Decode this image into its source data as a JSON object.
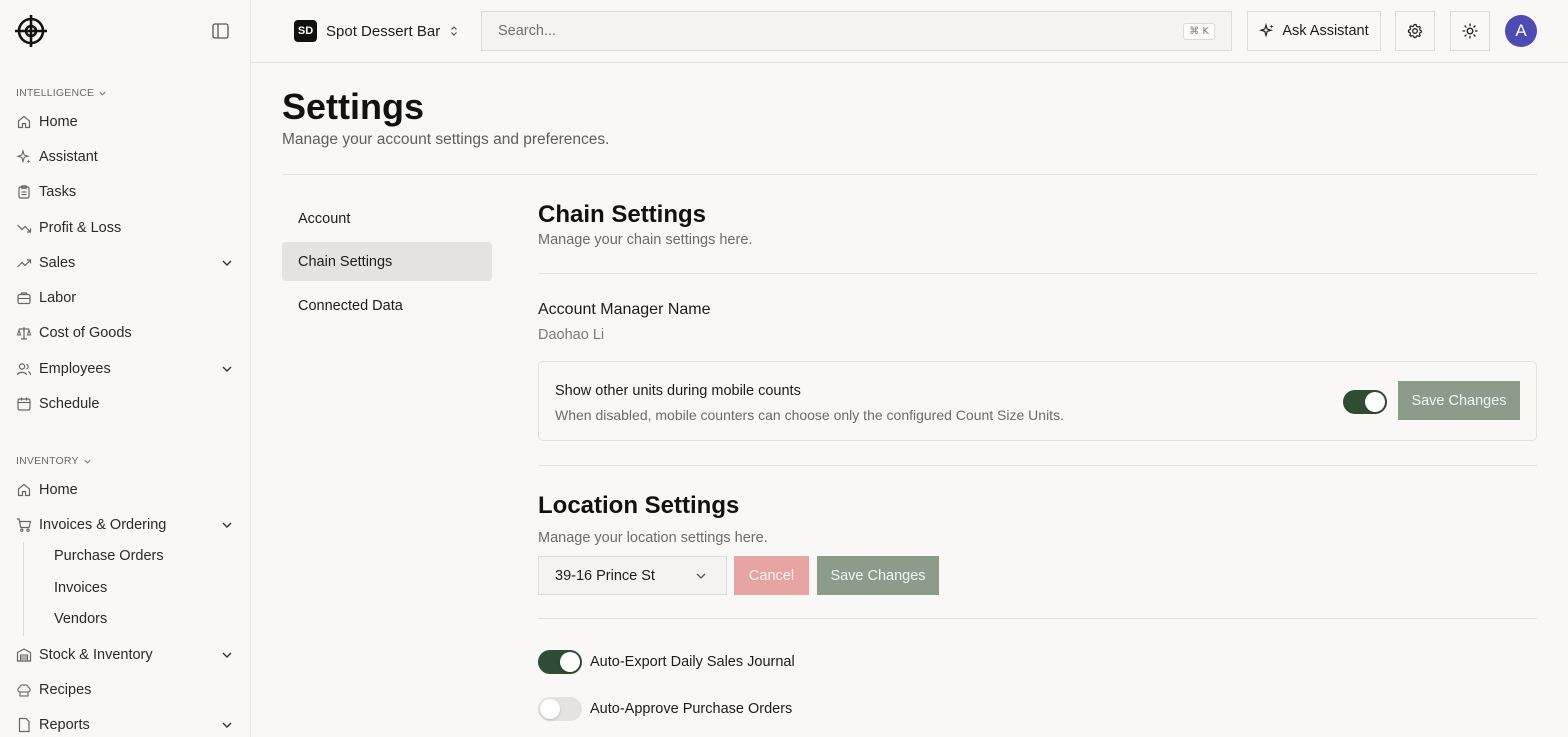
{
  "sidebar": {
    "intelligence_label": "INTELLIGENCE",
    "inventory_label": "INVENTORY",
    "intelligence_items": [
      {
        "label": "Home",
        "icon": "home-icon"
      },
      {
        "label": "Assistant",
        "icon": "sparkle-icon"
      },
      {
        "label": "Tasks",
        "icon": "clipboard-icon"
      },
      {
        "label": "Profit & Loss",
        "icon": "trending-down-icon"
      },
      {
        "label": "Sales",
        "icon": "trending-up-icon"
      },
      {
        "label": "Labor",
        "icon": "briefcase-icon"
      },
      {
        "label": "Cost of Goods",
        "icon": "scale-icon"
      },
      {
        "label": "Employees",
        "icon": "users-icon"
      },
      {
        "label": "Schedule",
        "icon": "calendar-icon"
      }
    ],
    "inventory_items": [
      {
        "label": "Home",
        "icon": "home-icon"
      },
      {
        "label": "Invoices & Ordering",
        "icon": "cart-icon"
      },
      {
        "label": "Stock & Inventory",
        "icon": "warehouse-icon"
      },
      {
        "label": "Recipes",
        "icon": "chef-hat-icon"
      },
      {
        "label": "Reports",
        "icon": "file-icon"
      }
    ],
    "invoices_sub": [
      "Purchase Orders",
      "Invoices",
      "Vendors"
    ]
  },
  "topbar": {
    "org_badge": "SD",
    "org_name": "Spot Dessert Bar",
    "search_placeholder": "Search...",
    "search_shortcut": "⌘ K",
    "ask_label": "Ask Assistant",
    "avatar_initial": "A"
  },
  "page": {
    "title": "Settings",
    "subtitle": "Manage your account settings and preferences.",
    "tabs": [
      "Account",
      "Chain Settings",
      "Connected Data"
    ],
    "active_tab": "Chain Settings"
  },
  "chain": {
    "title": "Chain Settings",
    "subtitle": "Manage your chain settings here.",
    "manager_label": "Account Manager Name",
    "manager_value": "Daohao Li",
    "mobile_units_title": "Show other units during mobile counts",
    "mobile_units_desc": "When disabled, mobile counters can choose only the configured Count Size Units.",
    "mobile_units_enabled": true,
    "save_label": "Save Changes"
  },
  "location": {
    "title": "Location Settings",
    "subtitle": "Manage your location settings here.",
    "selected_location": "39-16 Prince St",
    "cancel_label": "Cancel",
    "save_label": "Save Changes",
    "auto_export_label": "Auto-Export Daily Sales Journal",
    "auto_export_enabled": true,
    "auto_approve_label": "Auto-Approve Purchase Orders",
    "auto_approve_enabled": false
  },
  "colors": {
    "accent": "#2f4c34",
    "save_button": "#8c9c8b",
    "cancel_button": "#e6a4a2",
    "avatar": "#4d4cb0"
  }
}
